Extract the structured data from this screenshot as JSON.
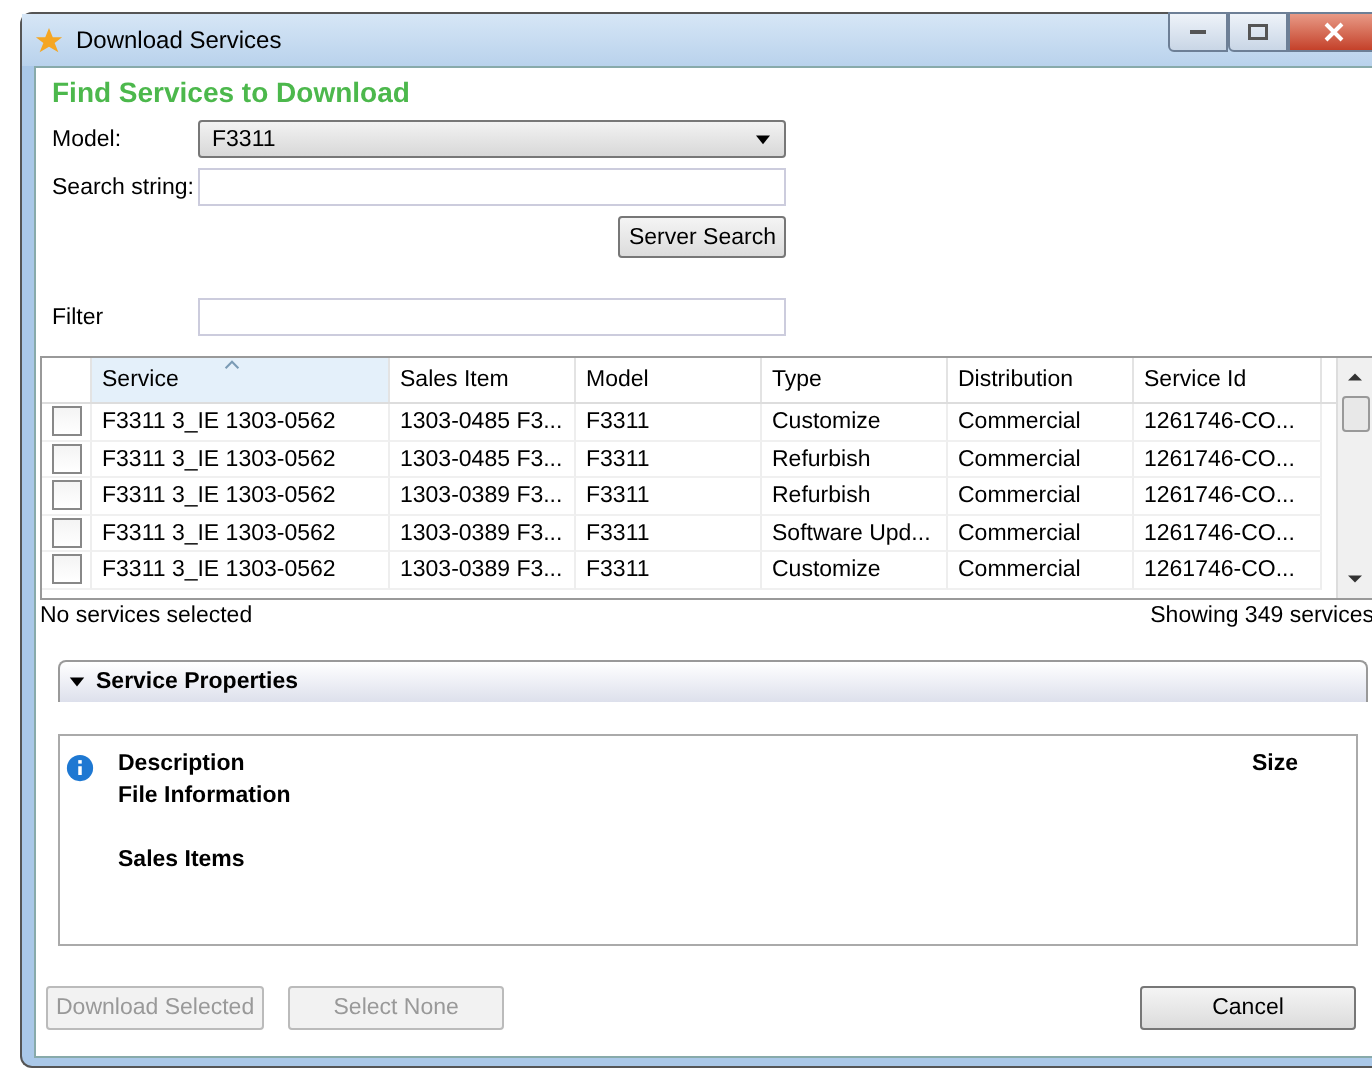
{
  "window": {
    "title": "Download Services"
  },
  "heading": "Find Services to Download",
  "model": {
    "label": "Model:",
    "value": "F3311"
  },
  "search": {
    "label": "Search string:"
  },
  "server_search_button": {
    "label": "Server Search"
  },
  "filter": {
    "label": "Filter"
  },
  "table": {
    "columns": [
      {
        "label": "Service",
        "sorted": true
      },
      {
        "label": "Sales Item",
        "sorted": false
      },
      {
        "label": "Model",
        "sorted": false
      },
      {
        "label": "Type",
        "sorted": false
      },
      {
        "label": "Distribution",
        "sorted": false
      },
      {
        "label": "Service Id",
        "sorted": false
      }
    ],
    "rows": [
      {
        "checked": false,
        "cells": [
          "F3311 3_IE 1303-0562",
          "1303-0485 F3...",
          "F3311",
          "Customize",
          "Commercial",
          "1261746-CO..."
        ]
      },
      {
        "checked": false,
        "cells": [
          "F3311 3_IE 1303-0562",
          "1303-0485 F3...",
          "F3311",
          "Refurbish",
          "Commercial",
          "1261746-CO..."
        ]
      },
      {
        "checked": false,
        "cells": [
          "F3311 3_IE 1303-0562",
          "1303-0389 F3...",
          "F3311",
          "Refurbish",
          "Commercial",
          "1261746-CO..."
        ]
      },
      {
        "checked": false,
        "cells": [
          "F3311 3_IE 1303-0562",
          "1303-0389 F3...",
          "F3311",
          "Software Upd...",
          "Commercial",
          "1261746-CO..."
        ]
      },
      {
        "checked": false,
        "cells": [
          "F3311 3_IE 1303-0562",
          "1303-0389 F3...",
          "F3311",
          "Customize",
          "Commercial",
          "1261746-CO..."
        ]
      }
    ]
  },
  "status": {
    "left": "No services selected",
    "right": "Showing 349 services"
  },
  "properties": {
    "title": "Service Properties",
    "expanded": true,
    "description_label": "Description",
    "size_label": "Size",
    "file_info_label": "File Information",
    "sales_items_label": "Sales Items"
  },
  "buttons": {
    "left": [
      {
        "label": "Download Selected",
        "disabled": true
      },
      {
        "label": "Select None",
        "disabled": true
      }
    ],
    "right": [
      {
        "label": "Cancel",
        "disabled": false
      }
    ]
  }
}
